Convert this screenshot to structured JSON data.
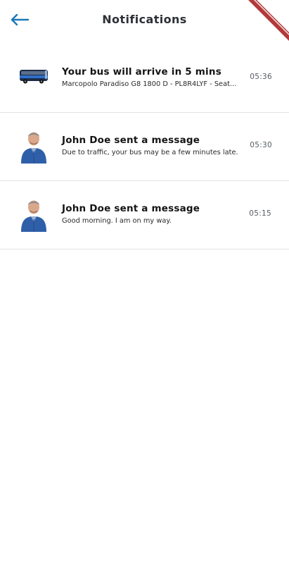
{
  "header": {
    "title": "Notifications",
    "back_icon": "arrow-left-icon"
  },
  "colors": {
    "accent": "#1a78b6",
    "divider": "#e2e2e2",
    "banner": "#b23a3a"
  },
  "notifications": [
    {
      "icon": "bus-icon",
      "title_prefix": "Your bus will arrive in ",
      "title_emphasis": "5",
      "title_suffix": " mins",
      "body": "Marcopolo Paradiso G8 1800 D - PL8R4LYF - Seat...",
      "time": "05:36"
    },
    {
      "icon": "user-avatar",
      "title": "John Doe sent a message",
      "body": "Due to traffic, your bus may be a few minutes late.",
      "time": "05:30"
    },
    {
      "icon": "user-avatar",
      "title": "John Doe sent a message",
      "body": "Good morning. I am on my way.",
      "time": "05:15"
    }
  ]
}
